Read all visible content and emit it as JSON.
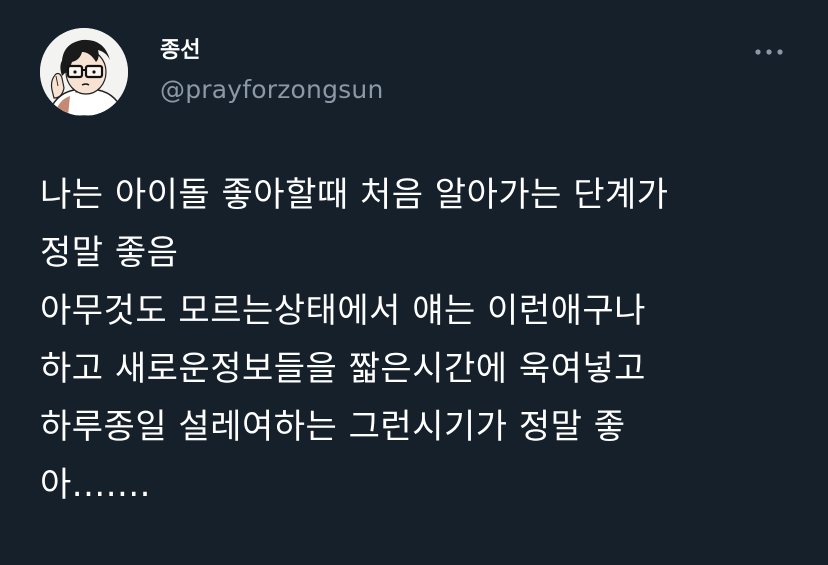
{
  "tweet": {
    "author": {
      "display_name": "종선",
      "handle": "@prayforzongsun",
      "avatar": "avatar-illustration"
    },
    "more_icon": "more-horizontal-icon",
    "lines": [
      "나는 아이돌 좋아할때 처음 알아가는 단계가",
      "정말 좋음",
      "아무것도 모르는상태에서 얘는 이런애구나",
      "하고 새로운정보들을 짧은시간에 욱여넣고",
      "하루종일 설레여하는 그런시기가 정말 좋",
      "아......."
    ]
  },
  "colors": {
    "background": "#15202b",
    "text": "#ffffff",
    "secondary_text": "#8b98a5"
  }
}
